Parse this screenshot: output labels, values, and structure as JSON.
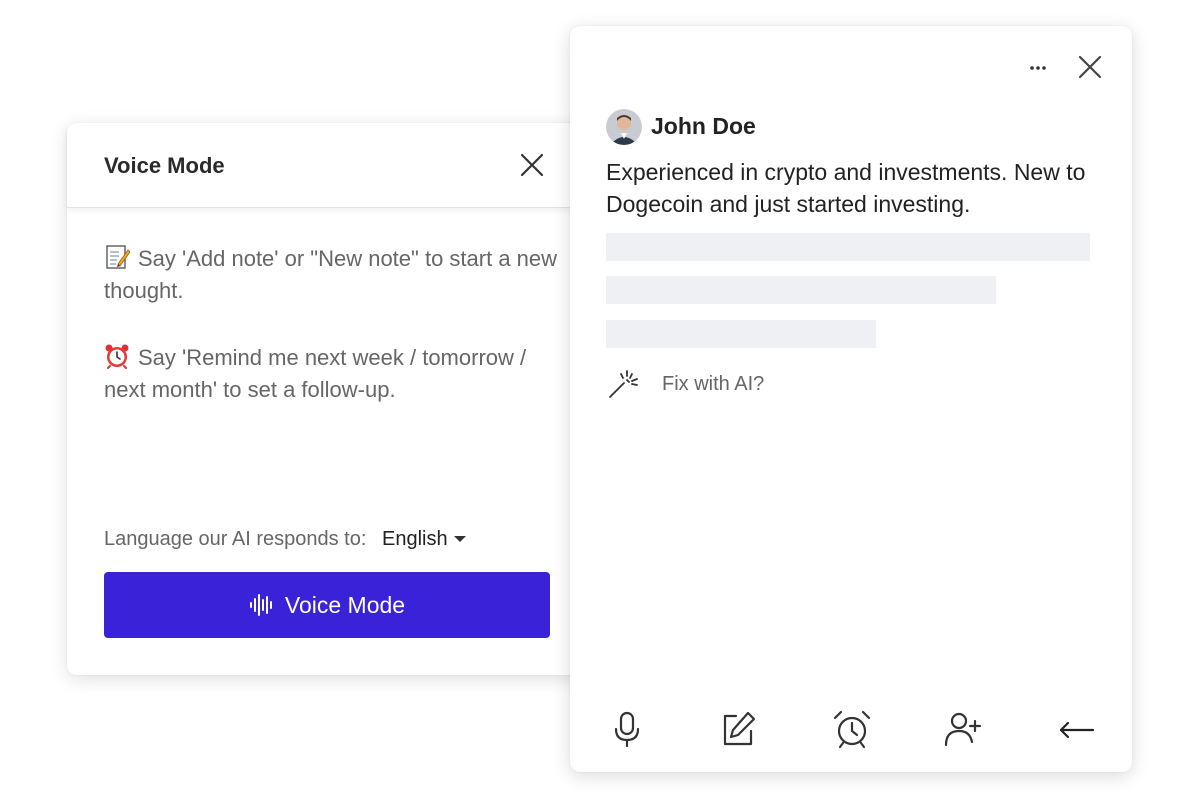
{
  "voice_panel": {
    "title": "Voice Mode",
    "instructions": [
      {
        "icon": "memo-emoji",
        "text": "Say 'Add note' or \"New note\" to start a new thought."
      },
      {
        "icon": "alarm-clock-emoji",
        "text": "Say 'Remind me next week / tomorrow / next month' to set a follow-up."
      }
    ],
    "language_label": "Language our AI responds to:",
    "language_value": "English",
    "button_label": "Voice Mode",
    "button_color": "#3a22d8"
  },
  "contact_panel": {
    "name": "John Doe",
    "description": "Experienced in crypto and investments. New to Dogecoin and just started investing.",
    "fix_label": "Fix with AI?",
    "toolbar": [
      "microphone-icon",
      "edit-note-icon",
      "alarm-clock-icon",
      "add-person-icon",
      "back-arrow-icon"
    ]
  }
}
